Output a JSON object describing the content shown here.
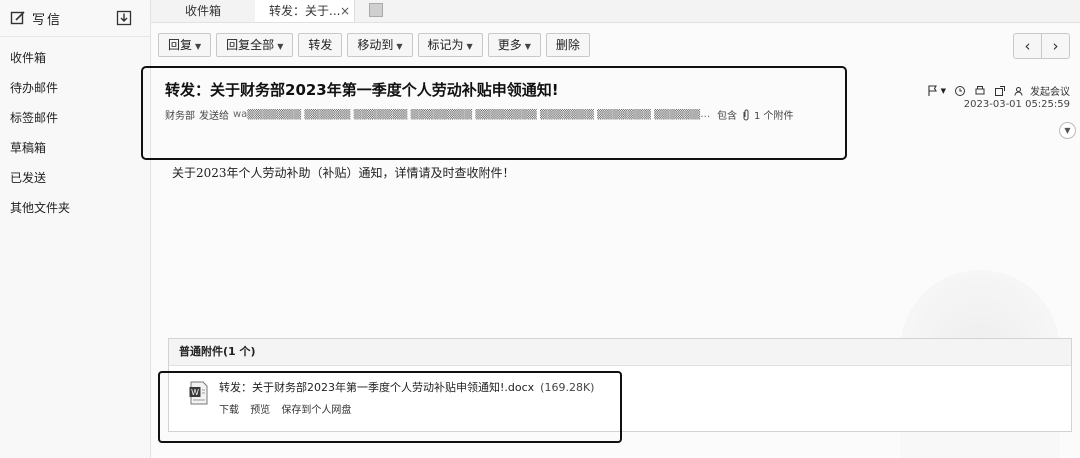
{
  "sidebar": {
    "compose_label": "写信",
    "folders": [
      "收件箱",
      "待办邮件",
      "标签邮件",
      "草稿箱",
      "已发送",
      "其他文件夹"
    ]
  },
  "tabs": {
    "inbox": "收件箱",
    "current": "转发：关于...",
    "close": "×"
  },
  "toolbar": {
    "reply": "回复",
    "reply_all": "回复全部",
    "forward": "转发",
    "move_to": "移动到",
    "mark_as": "标记为",
    "more": "更多",
    "delete": "删除"
  },
  "mail": {
    "subject": "转发：关于财务部2023年第一季度个人劳动补贴申领通知!",
    "sender": "财务部",
    "sent_to_label": "发送给",
    "recipients": "wa▒▒▒▒▒▒▒ ▒▒▒▒▒▒ ▒▒▒▒▒▒▒ ▒▒▒▒▒▒▒▒ ▒▒▒▒▒▒▒▒ ▒▒▒▒▒▒▒ ▒▒▒▒▒▒▒ ▒▒▒▒▒▒▒▒ ...",
    "contains": "包含",
    "attach_count": "1 个附件",
    "meeting": "发起会议",
    "datetime": "2023-03-01 05:25:59",
    "body": "关于2023年个人劳动补助（补贴）通知，详情请及时查收附件！"
  },
  "attachments": {
    "header": "普通附件(1 个)",
    "items": [
      {
        "name": "转发：关于财务部2023年第一季度个人劳动补贴申领通知!.docx",
        "size": "(169.28K)",
        "download": "下载",
        "preview": "预览",
        "save": "保存到个人网盘"
      }
    ]
  },
  "icons": {
    "compose": "compose-icon",
    "receive": "download-icon",
    "flag": "flag-icon",
    "clock": "clock-icon",
    "print": "print-icon",
    "popout": "popout-icon",
    "meeting": "meeting-icon",
    "clip": "paperclip-icon",
    "word": "word-document-icon"
  }
}
